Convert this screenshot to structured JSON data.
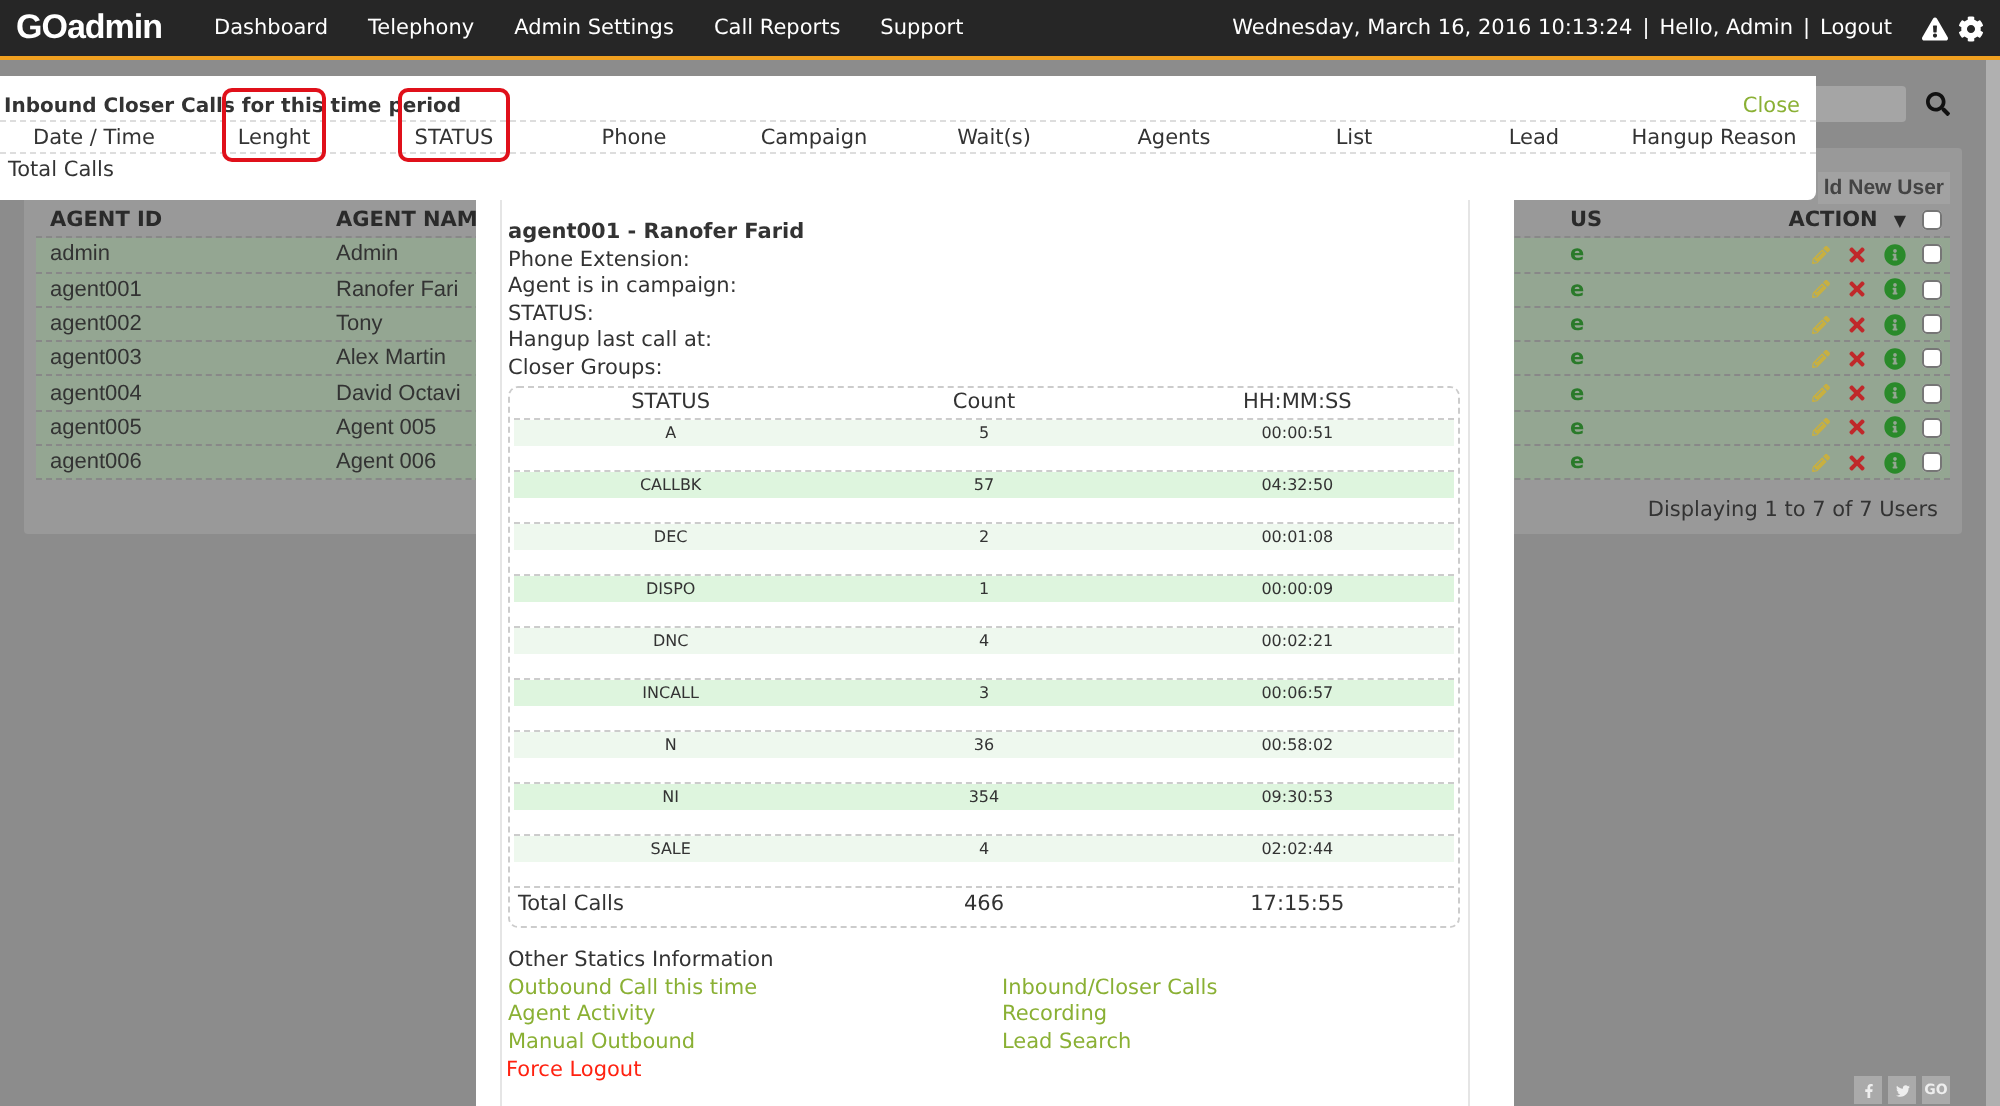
{
  "top_nav": {
    "logo": "GOadmin",
    "items": [
      "Dashboard",
      "Telephony",
      "Admin Settings",
      "Call Reports",
      "Support"
    ],
    "datetime": "Wednesday, March 16, 2016 10:13:24",
    "separator": "|",
    "greeting": "Hello, Admin",
    "logout": "Logout"
  },
  "users_panel": {
    "add_button": "ld New User",
    "columns": [
      "AGENT ID",
      "AGENT NAM",
      "US",
      "ACTION"
    ],
    "sort_mark": "▼",
    "select_all_checked": false,
    "rows": [
      {
        "id": "admin",
        "name": "Admin",
        "status": "e",
        "checked": false
      },
      {
        "id": "agent001",
        "name": "Ranofer Fari",
        "status": "e",
        "checked": false
      },
      {
        "id": "agent002",
        "name": "Tony",
        "status": "e",
        "checked": false
      },
      {
        "id": "agent003",
        "name": "Alex Martin",
        "status": "e",
        "checked": false
      },
      {
        "id": "agent004",
        "name": "David Octavi",
        "status": "e",
        "checked": false
      },
      {
        "id": "agent005",
        "name": "Agent 005",
        "status": "e",
        "checked": false
      },
      {
        "id": "agent006",
        "name": "Agent 006",
        "status": "e",
        "checked": false
      }
    ],
    "footer": "Displaying 1 to 7 of 7 Users"
  },
  "popup": {
    "title": "Inbound Closer Calls for this time period",
    "close": "Close",
    "columns": [
      {
        "label": "Date / Time",
        "highlighted": false
      },
      {
        "label": "Lenght",
        "highlighted": true
      },
      {
        "label": "STATUS",
        "highlighted": true
      },
      {
        "label": "Phone",
        "highlighted": false
      },
      {
        "label": "Campaign",
        "highlighted": false
      },
      {
        "label": "Wait(s)",
        "highlighted": false
      },
      {
        "label": "Agents",
        "highlighted": false
      },
      {
        "label": "List",
        "highlighted": false
      },
      {
        "label": "Lead",
        "highlighted": false
      },
      {
        "label": "Hangup Reason",
        "highlighted": false
      }
    ],
    "total_label": "Total Calls"
  },
  "modal": {
    "agent_title": "agent001 - Ranofer Farid",
    "fields": [
      "Phone Extension:",
      "Agent is in campaign:",
      "STATUS:",
      "Hangup last call at:",
      "Closer Groups:"
    ],
    "stats": {
      "columns": [
        "STATUS",
        "Count",
        "HH:MM:SS"
      ],
      "rows": [
        {
          "status": "A",
          "count": "5",
          "time": "00:00:51"
        },
        {
          "status": "CALLBK",
          "count": "57",
          "time": "04:32:50"
        },
        {
          "status": "DEC",
          "count": "2",
          "time": "00:01:08"
        },
        {
          "status": "DISPO",
          "count": "1",
          "time": "00:00:09"
        },
        {
          "status": "DNC",
          "count": "4",
          "time": "00:02:21"
        },
        {
          "status": "INCALL",
          "count": "3",
          "time": "00:06:57"
        },
        {
          "status": "N",
          "count": "36",
          "time": "00:58:02"
        },
        {
          "status": "NI",
          "count": "354",
          "time": "09:30:53"
        },
        {
          "status": "SALE",
          "count": "4",
          "time": "02:02:44"
        }
      ],
      "total": {
        "label": "Total Calls",
        "count": "466",
        "time": "17:15:55"
      }
    },
    "other_title": "Other Statics Information",
    "links": [
      "Outbound Call this time",
      "Inbound/Closer Calls",
      "Agent Activity",
      "Recording",
      "Manual Outbound",
      "Lead Search"
    ],
    "force_logout": "Force Logout"
  },
  "social": {
    "go": "GO"
  }
}
